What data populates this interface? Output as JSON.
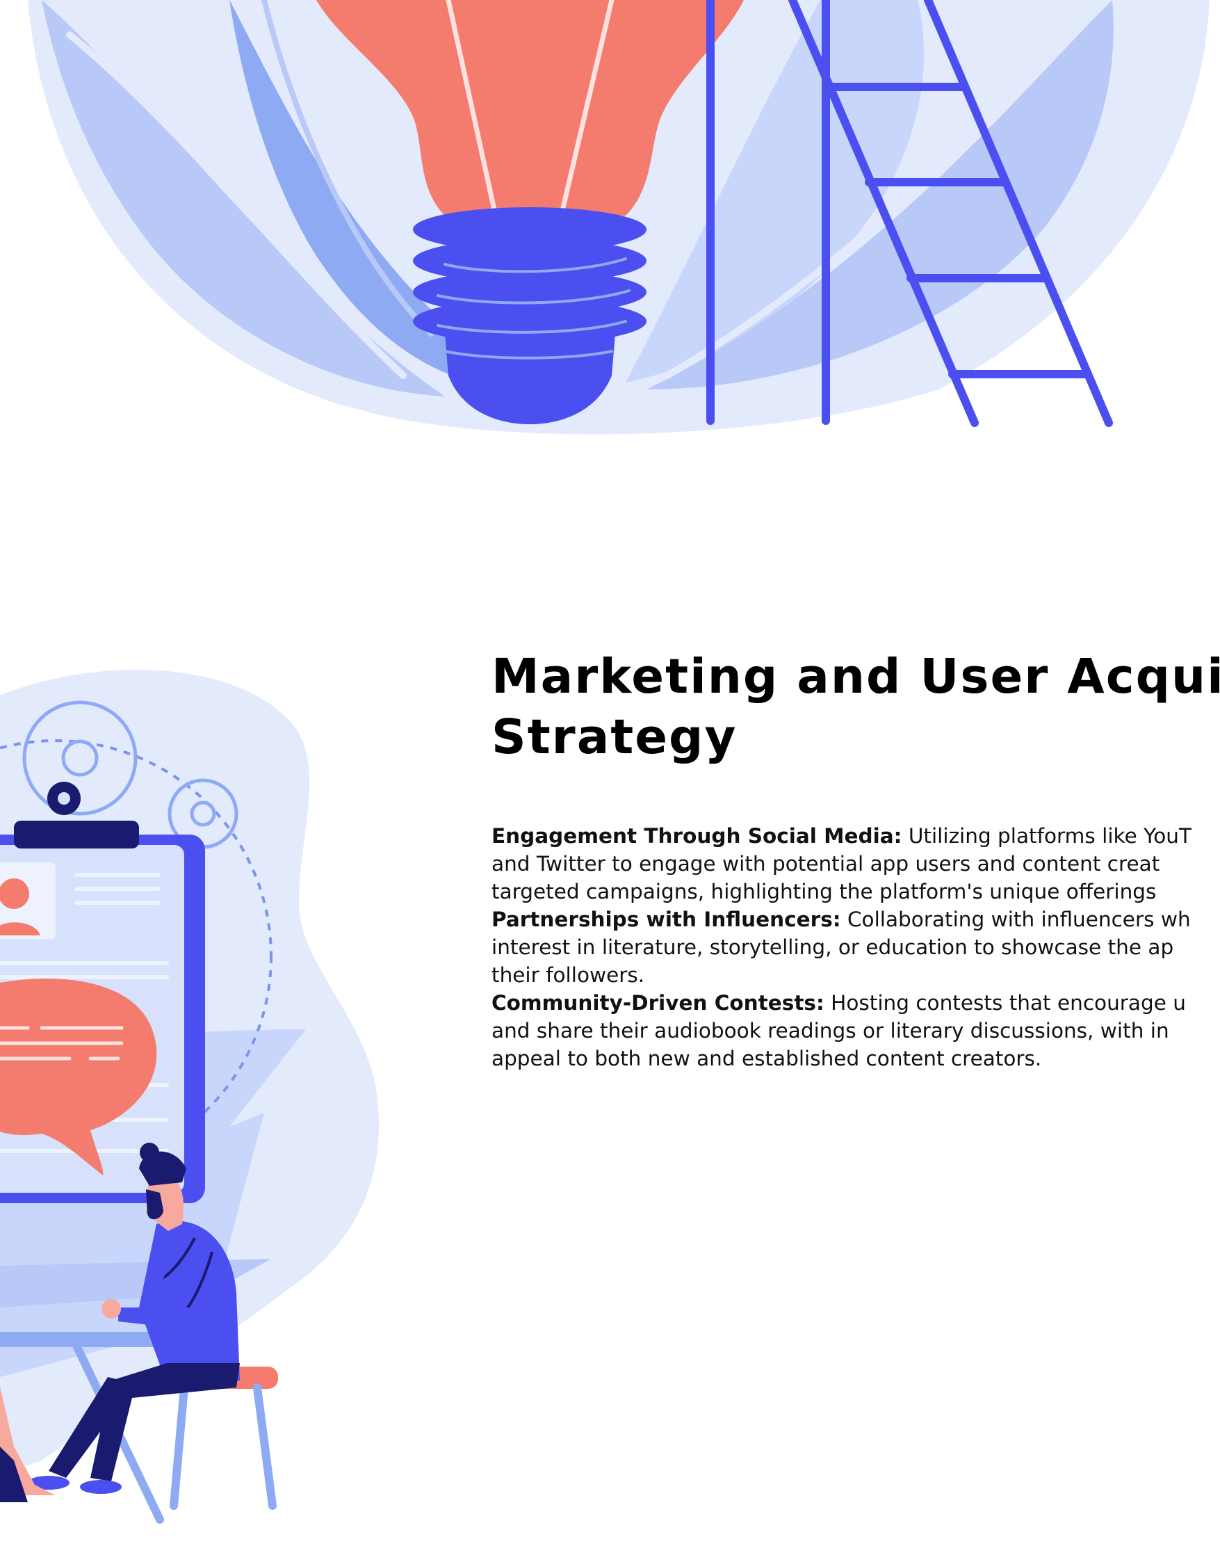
{
  "section": {
    "title_lines": [
      "Marketing and User Acqui",
      "Strategy"
    ]
  },
  "bullets": [
    {
      "label": "Engagement Through Social Media:",
      "lines": [
        " Utilizing platforms like YouT",
        "and Twitter to engage with potential app users and content creat",
        "targeted campaigns, highlighting the platform's unique offerings"
      ]
    },
    {
      "label": "Partnerships with Influencers:",
      "lines": [
        " Collaborating with influencers wh",
        "interest in literature, storytelling, or education to showcase the ap",
        "their followers."
      ]
    },
    {
      "label": "Community-Driven Contests:",
      "lines": [
        " Hosting contests that encourage u",
        "and share their audiobook readings or literary discussions, with in",
        "appeal to both new and established content creators."
      ]
    }
  ],
  "colors": {
    "accent_blue": "#4b4ff0",
    "coral": "#f47c6f",
    "light_blue": "#c9d6fb",
    "mid_blue": "#8eaaf3",
    "dark_navy": "#1a1a6e"
  },
  "illustrations": {
    "top": "lightbulb-with-ladder-illustration",
    "side": "man-with-clipboard-illustration"
  }
}
